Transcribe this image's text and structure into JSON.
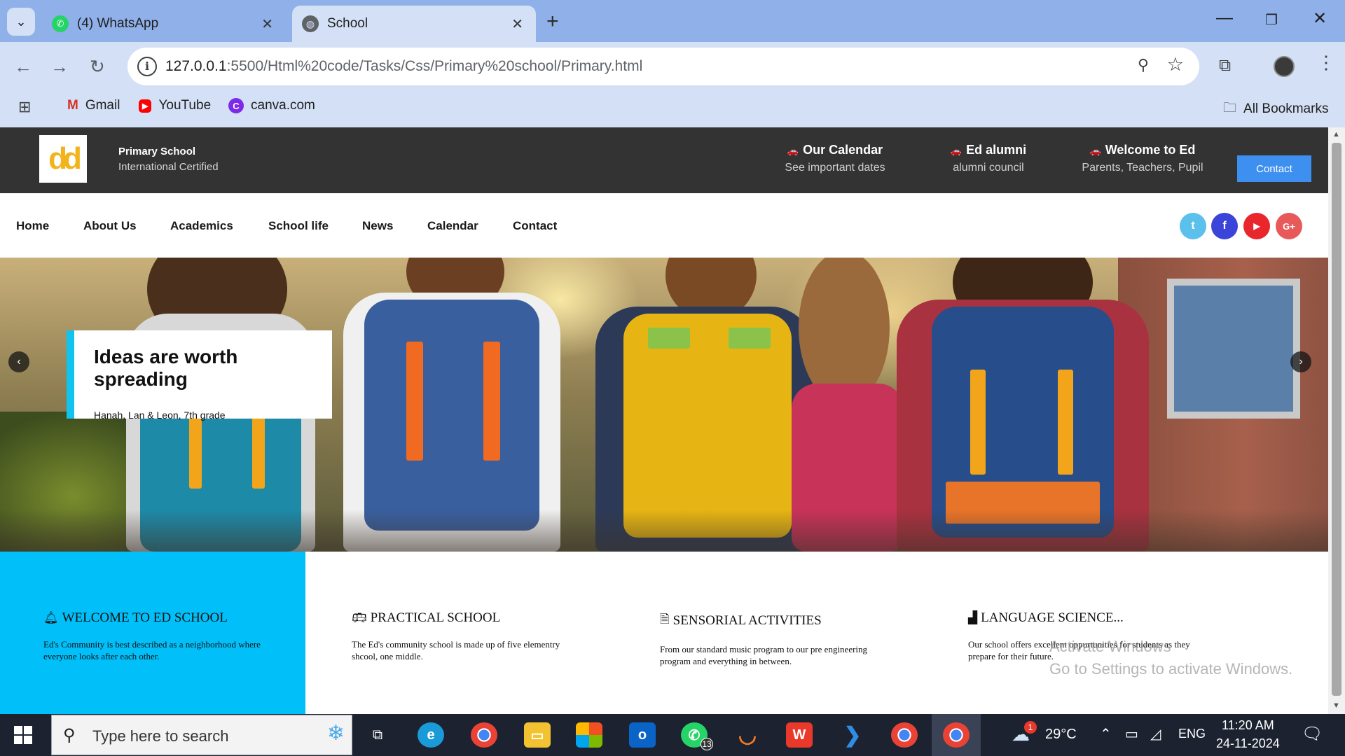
{
  "browser": {
    "tabs": [
      {
        "title": "(4) WhatsApp",
        "icon": "whatsapp-icon",
        "active": false
      },
      {
        "title": "School",
        "icon": "globe-icon",
        "active": true
      }
    ],
    "url_host": "127.0.0.1",
    "url_path": ":5500/Html%20code/Tasks/Css/Primary%20school/Primary.html",
    "bookmarks": [
      {
        "label": "Gmail",
        "icon": "gmail-icon"
      },
      {
        "label": "YouTube",
        "icon": "youtube-icon"
      },
      {
        "label": "canva.com",
        "icon": "canva-icon"
      }
    ],
    "all_bookmarks": "All Bookmarks"
  },
  "site": {
    "logo_text": "dd",
    "brand_title": "Primary School",
    "brand_subtitle": "International Certified",
    "info_blocks": [
      {
        "title": "Our Calendar",
        "subtitle": "See important dates",
        "icon": "car-icon"
      },
      {
        "title": "Ed alumni",
        "subtitle": "alumni council",
        "icon": "car-icon"
      },
      {
        "title": "Welcome to Ed",
        "subtitle": "Parents, Teachers, Pupil",
        "icon": "car-icon"
      }
    ],
    "contact_button": "Contact",
    "nav": [
      "Home",
      "About Us",
      "Academics",
      "School life",
      "News",
      "Calendar",
      "Contact"
    ],
    "social": [
      {
        "name": "twitter-icon",
        "glyph": "t",
        "color": "#5bc0eb"
      },
      {
        "name": "facebook-icon",
        "glyph": "f",
        "color": "#3b44d8"
      },
      {
        "name": "youtube-icon",
        "glyph": "▶",
        "color": "#e8262b"
      },
      {
        "name": "google-plus-icon",
        "glyph": "G+",
        "color": "#e85a5a"
      }
    ],
    "hero": {
      "caption_title": "Ideas are worth spreading",
      "caption_subtitle": "Hanah, Lan & Leon, 7th grade"
    },
    "features": [
      {
        "title": "WELCOME TO ED SCHOOL",
        "icon": "bell-icon",
        "text": "Ed's Community is best described as a neighborhood where everyone looks after each other."
      },
      {
        "title": "PRACTICAL SCHOOL",
        "icon": "bus-icon",
        "text": "The Ed's community school is made up of five elementry shcool, one middle."
      },
      {
        "title": "SENSORIAL ACTIVITIES",
        "icon": "file-icon",
        "text": "From our standard music program to our pre engineering program and everything in between."
      },
      {
        "title": "LANGUAGE SCIENCE...",
        "icon": "podium-icon",
        "text": "Our school offers excellent oppurtunities for students as they prepare for their future."
      }
    ],
    "watermark": {
      "line1": "Activate Windows",
      "line2": "Go to Settings to activate Windows."
    }
  },
  "taskbar": {
    "search_placeholder": "Type here to search",
    "whatsapp_badge": "13",
    "weather_badge": "1",
    "temperature": "29°C",
    "language": "ENG",
    "time": "11:20 AM",
    "date": "24-11-2024"
  }
}
